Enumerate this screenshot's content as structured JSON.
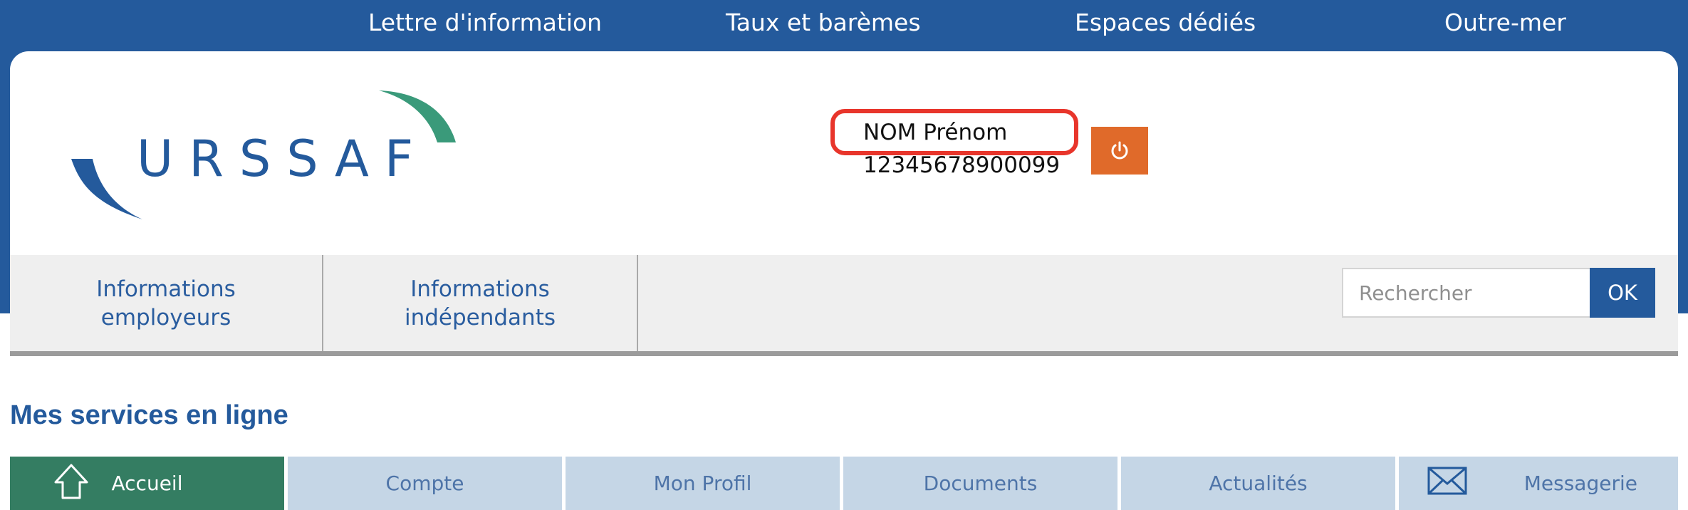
{
  "top_nav": [
    {
      "label": "Lettre d'information"
    },
    {
      "label": "Taux et barèmes"
    },
    {
      "label": "Espaces dédiés"
    },
    {
      "label": "Outre-mer"
    }
  ],
  "logo": {
    "text": "URSSAF"
  },
  "user": {
    "name": "NOM Prénom",
    "id": "12345678900099"
  },
  "menu": [
    {
      "label": "Informations employeurs"
    },
    {
      "label": "Informations indépendants"
    }
  ],
  "search": {
    "placeholder": "Rechercher",
    "button": "OK"
  },
  "section_title": "Mes services en ligne",
  "tabs": [
    {
      "label": "Accueil",
      "icon": "home-icon",
      "active": true
    },
    {
      "label": "Compte"
    },
    {
      "label": "Mon Profil"
    },
    {
      "label": "Documents"
    },
    {
      "label": "Actualités"
    },
    {
      "label": "Messagerie",
      "icon": "envelope-icon"
    }
  ],
  "colors": {
    "brand_blue": "#245a9c",
    "brand_green": "#3a9a7a",
    "active_tab": "#347d62",
    "power_button": "#e06a2a",
    "highlight": "#e8352b"
  }
}
